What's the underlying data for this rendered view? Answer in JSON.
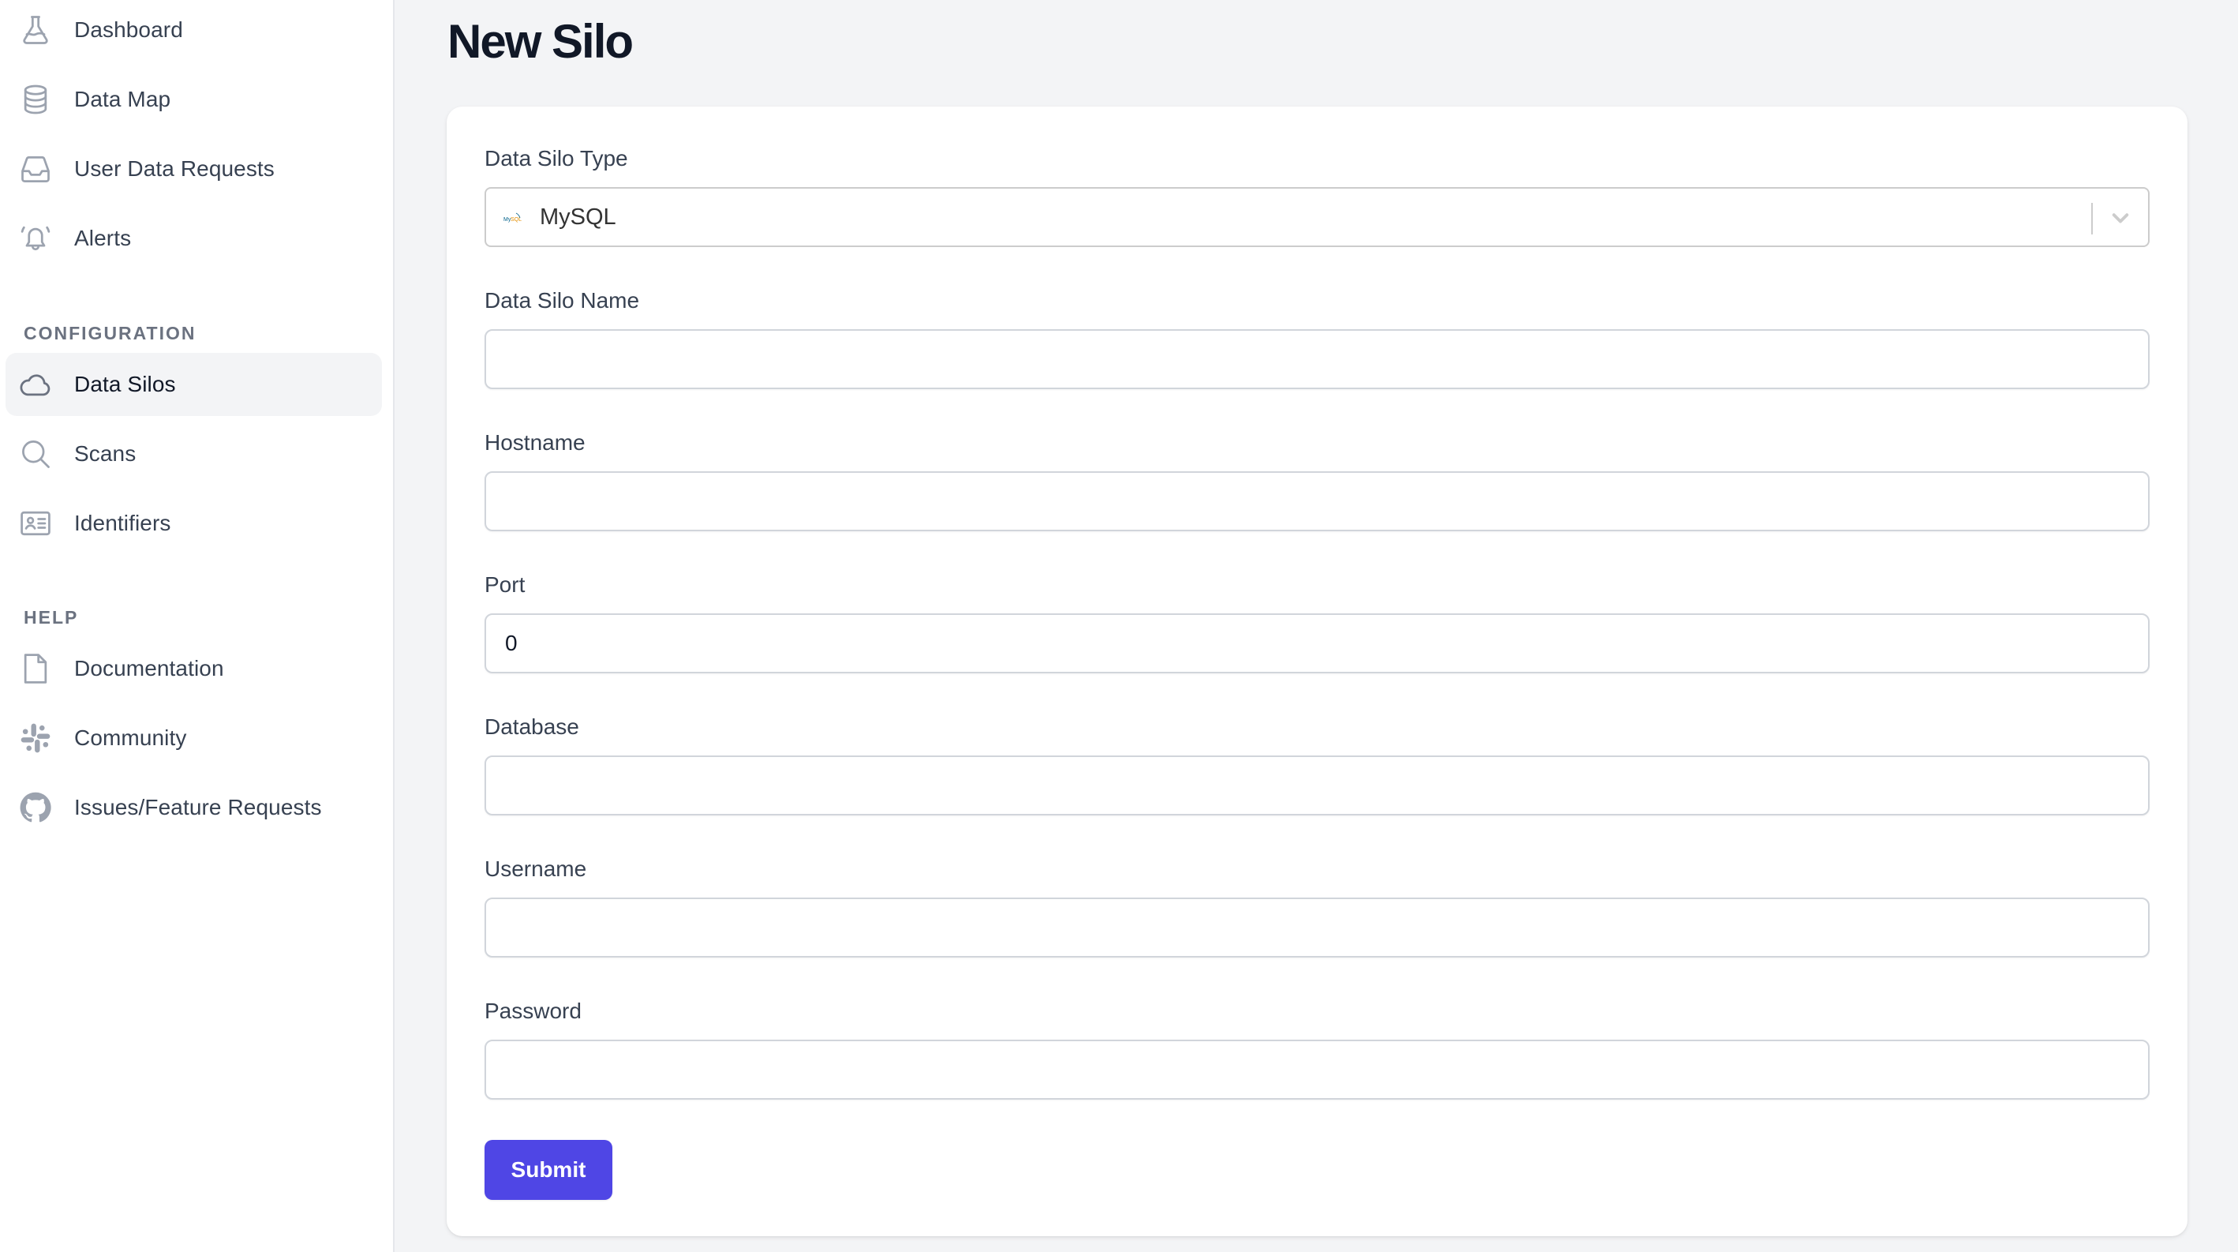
{
  "sidebar": {
    "main_items": [
      {
        "label": "Dashboard",
        "icon": "beaker-icon"
      },
      {
        "label": "Data Map",
        "icon": "database-icon"
      },
      {
        "label": "User Data Requests",
        "icon": "inbox-icon"
      },
      {
        "label": "Alerts",
        "icon": "bell-icon"
      }
    ],
    "configuration": {
      "title": "CONFIGURATION",
      "items": [
        {
          "label": "Data Silos",
          "icon": "cloud-icon",
          "active": true
        },
        {
          "label": "Scans",
          "icon": "search-icon"
        },
        {
          "label": "Identifiers",
          "icon": "id-card-icon"
        }
      ]
    },
    "help": {
      "title": "HELP",
      "items": [
        {
          "label": "Documentation",
          "icon": "document-icon"
        },
        {
          "label": "Community",
          "icon": "slack-icon"
        },
        {
          "label": "Issues/Feature Requests",
          "icon": "github-icon"
        }
      ]
    }
  },
  "main": {
    "title": "New Silo",
    "form": {
      "silo_type": {
        "label": "Data Silo Type",
        "value": "MySQL",
        "icon": "mysql-logo-icon"
      },
      "silo_name": {
        "label": "Data Silo Name",
        "value": ""
      },
      "hostname": {
        "label": "Hostname",
        "value": ""
      },
      "port": {
        "label": "Port",
        "value": "0"
      },
      "database": {
        "label": "Database",
        "value": ""
      },
      "username": {
        "label": "Username",
        "value": ""
      },
      "password": {
        "label": "Password",
        "value": ""
      },
      "submit_label": "Submit"
    }
  },
  "colors": {
    "accent": "#4f46e5",
    "page_background": "#f3f4f6",
    "active_nav_background": "#f3f4f6",
    "icon_gray": "#9ca3af"
  }
}
